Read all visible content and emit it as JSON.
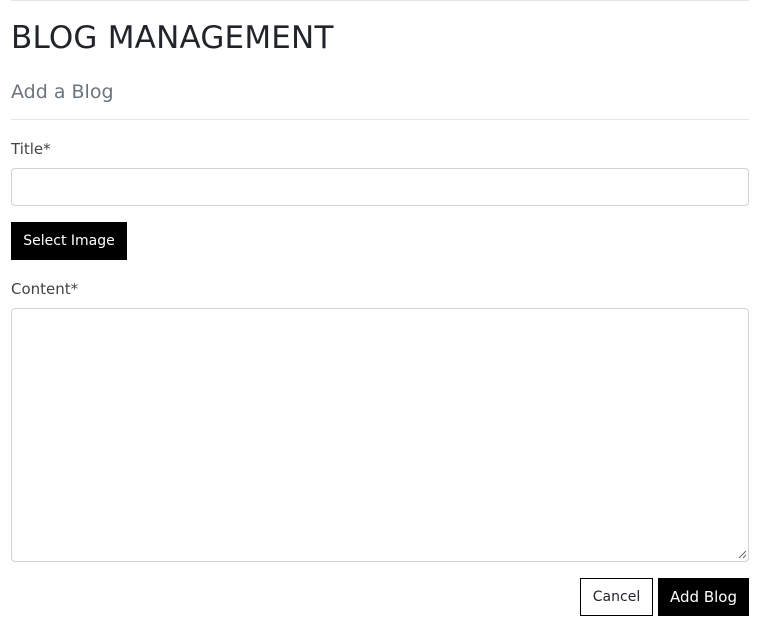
{
  "header": {
    "title": "BLOG MANAGEMENT",
    "subtitle": "Add a Blog"
  },
  "form": {
    "title_field": {
      "label": "Title*",
      "value": "",
      "placeholder": ""
    },
    "select_image_label": "Select Image",
    "content_field": {
      "label": "Content*",
      "value": "",
      "placeholder": ""
    }
  },
  "actions": {
    "cancel_label": "Cancel",
    "submit_label": "Add Blog"
  },
  "icons": {
    "textarea_resize": "resize-grip-icon"
  },
  "colors": {
    "primary_button": "#000000",
    "primary_button_text": "#ffffff",
    "section_title": "#6c757d",
    "border": "#cfd4da"
  }
}
